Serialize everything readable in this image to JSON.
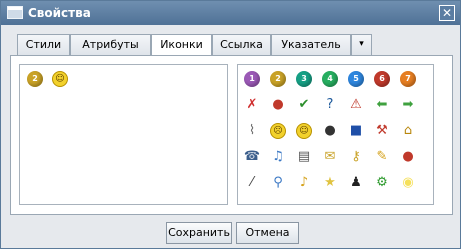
{
  "window": {
    "title": "Свойства",
    "close_glyph": "✕"
  },
  "tabs": [
    "Стили",
    "Атрибуты",
    "Иконки",
    "Ссылка",
    "Указатель"
  ],
  "active_tab": "Иконки",
  "tab_more_glyph": "▾",
  "selected_icons": [
    {
      "icon": "number-2-icon",
      "glyph": "2",
      "color": "#c9a227"
    },
    {
      "icon": "smiley-icon",
      "glyph": "☺",
      "color": "#f2d12c"
    }
  ],
  "icon_palette": [
    [
      {
        "icon": "number-1-icon",
        "glyph": "1",
        "color": "#9b59b6"
      },
      {
        "icon": "number-2-icon",
        "glyph": "2",
        "color": "#c9a227"
      },
      {
        "icon": "number-3-icon",
        "glyph": "3",
        "color": "#16a085"
      },
      {
        "icon": "number-4-icon",
        "glyph": "4",
        "color": "#27ae60"
      },
      {
        "icon": "number-5-icon",
        "glyph": "5",
        "color": "#2e86de"
      },
      {
        "icon": "number-6-icon",
        "glyph": "6",
        "color": "#c0392b"
      },
      {
        "icon": "number-7-icon",
        "glyph": "7",
        "color": "#e67e22"
      }
    ],
    [
      {
        "icon": "cross-arrow-icon",
        "glyph": "✗",
        "color": "#d03030"
      },
      {
        "icon": "traffic-light-icon",
        "glyph": "●",
        "color": "#c0392b"
      },
      {
        "icon": "checkmark-icon",
        "glyph": "✔",
        "color": "#2d8f2d"
      },
      {
        "icon": "question-icon",
        "glyph": "?",
        "color": "#1e5a9c"
      },
      {
        "icon": "warning-icon",
        "glyph": "⚠",
        "color": "#c0392b"
      },
      {
        "icon": "arrow-left-icon",
        "glyph": "⬅",
        "color": "#3fa13f"
      },
      {
        "icon": "arrow-right-icon",
        "glyph": "➡",
        "color": "#3fa13f"
      }
    ],
    [
      {
        "icon": "paperclip-icon",
        "glyph": "⌇",
        "color": "#6b6b6b"
      },
      {
        "icon": "sad-face-icon",
        "glyph": "☹",
        "color": "#f2d12c"
      },
      {
        "icon": "happy-face-icon",
        "glyph": "☺",
        "color": "#f2d12c"
      },
      {
        "icon": "bomb-icon",
        "glyph": "●",
        "color": "#333333"
      },
      {
        "icon": "monitor-icon",
        "glyph": "■",
        "color": "#1f4fa8"
      },
      {
        "icon": "hammer-icon",
        "glyph": "⚒",
        "color": "#c0392b"
      },
      {
        "icon": "house-icon",
        "glyph": "⌂",
        "color": "#b8860b"
      }
    ],
    [
      {
        "icon": "phone-icon",
        "glyph": "☎",
        "color": "#3b5e8c"
      },
      {
        "icon": "music-note-icon",
        "glyph": "♫",
        "color": "#3b78c4"
      },
      {
        "icon": "document-stack-icon",
        "glyph": "▤",
        "color": "#555555"
      },
      {
        "icon": "mail-icon",
        "glyph": "✉",
        "color": "#c9a227"
      },
      {
        "icon": "key-icon",
        "glyph": "⚷",
        "color": "#c9a227"
      },
      {
        "icon": "pencil-icon",
        "glyph": "✎",
        "color": "#d4a017"
      },
      {
        "icon": "traffic-light-icon",
        "glyph": "●",
        "color": "#c0392b"
      }
    ],
    [
      {
        "icon": "magic-wand-icon",
        "glyph": "⁄",
        "color": "#444444"
      },
      {
        "icon": "magnifier-icon",
        "glyph": "⚲",
        "color": "#3b78c4"
      },
      {
        "icon": "bell-icon",
        "glyph": "♪",
        "color": "#d4a017"
      },
      {
        "icon": "star-icon",
        "glyph": "★",
        "color": "#e0c341"
      },
      {
        "icon": "linux-penguin-icon",
        "glyph": "♟",
        "color": "#222222"
      },
      {
        "icon": "gear-icon",
        "glyph": "⚙",
        "color": "#2d9a2d"
      },
      {
        "icon": "lightbulb-icon",
        "glyph": "◉",
        "color": "#f5e05b"
      }
    ]
  ],
  "buttons": {
    "save": "Сохранить",
    "cancel": "Отмена"
  }
}
